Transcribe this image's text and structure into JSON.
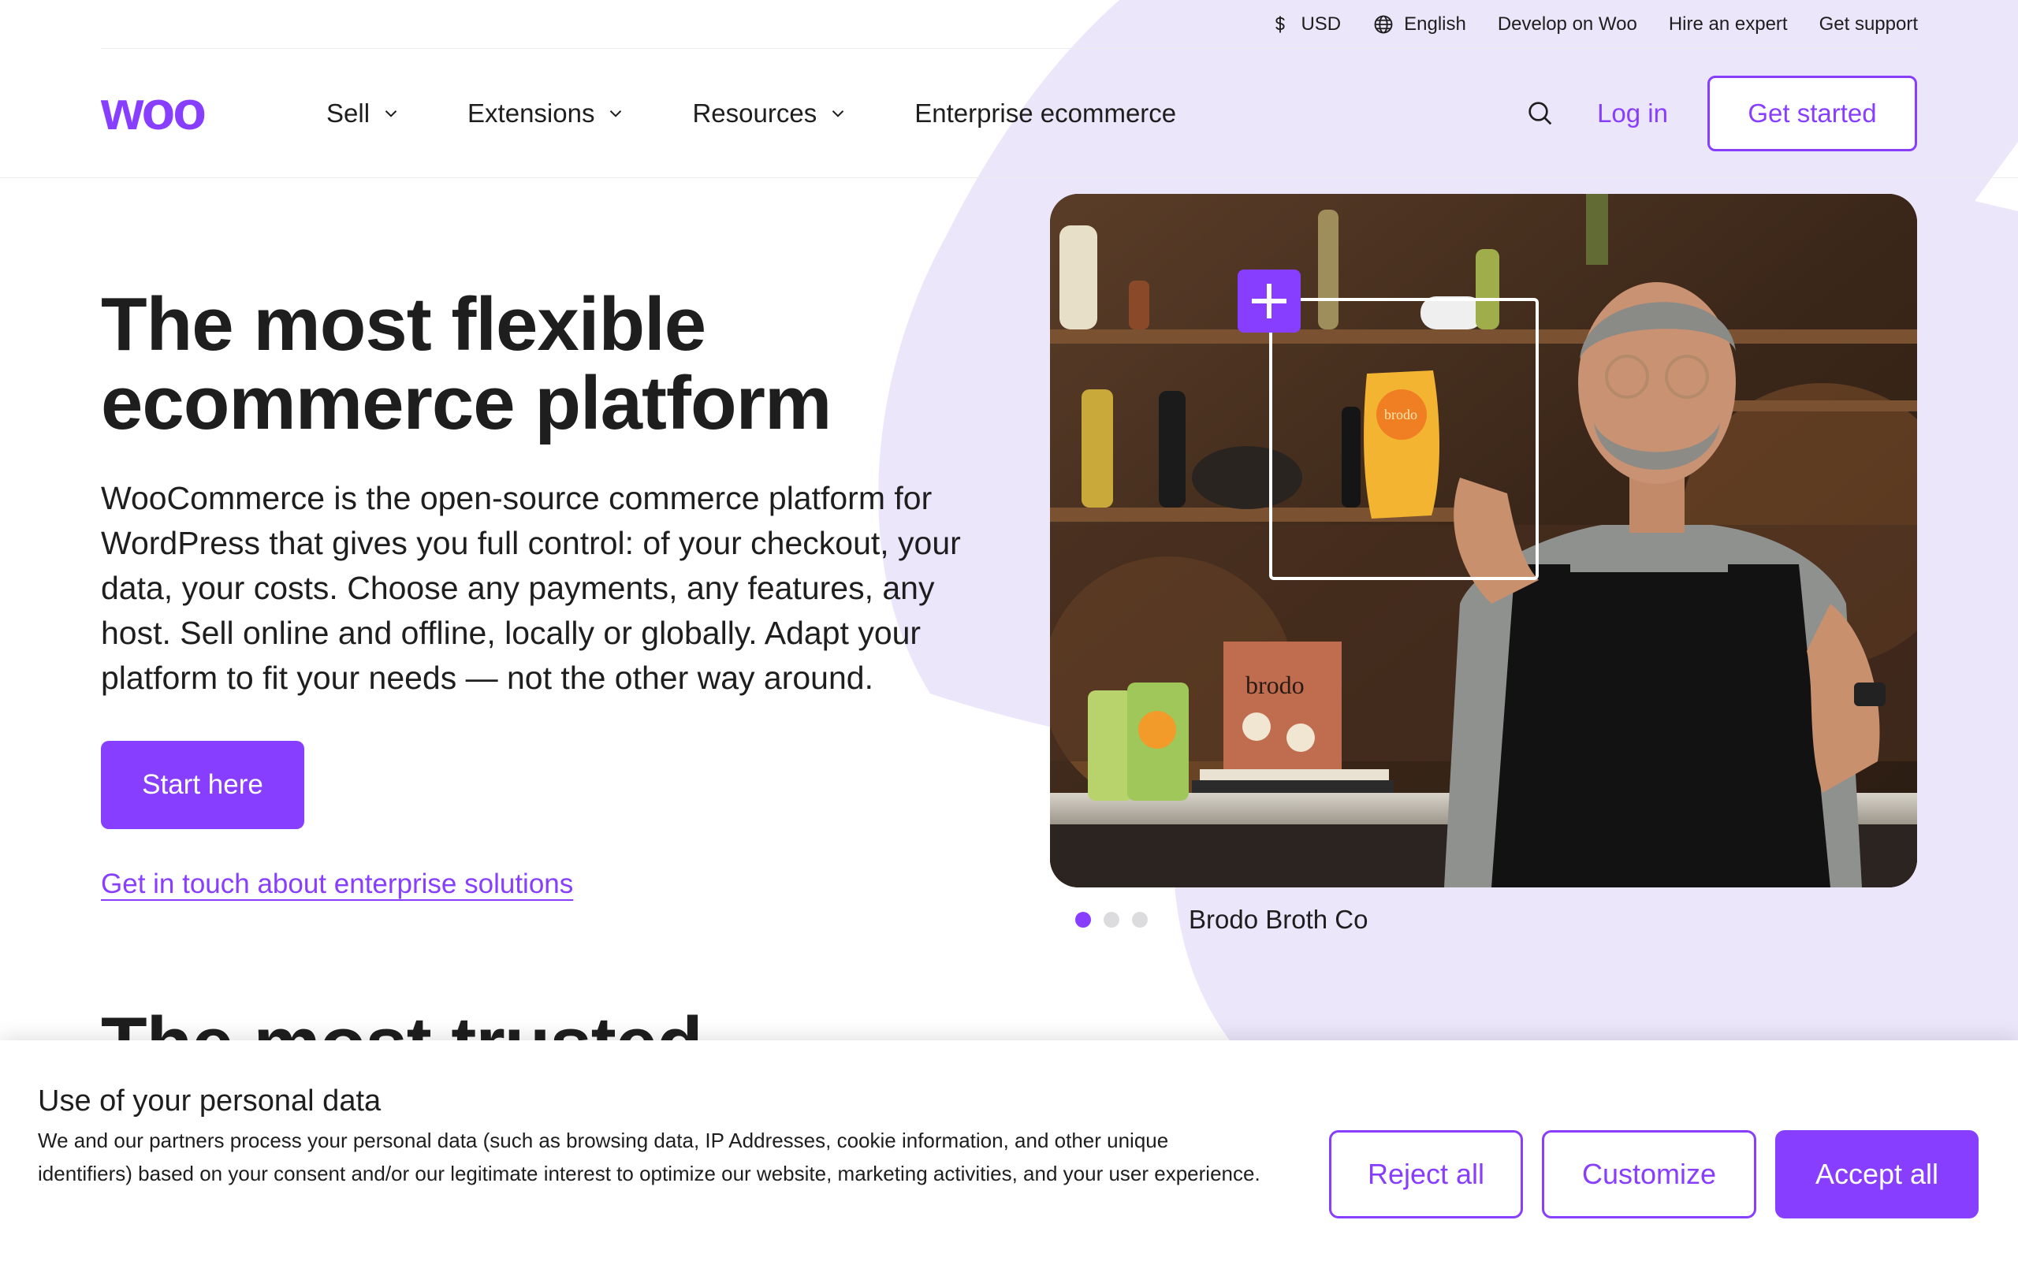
{
  "utility_bar": {
    "currency": "USD",
    "language": "English",
    "links": [
      "Develop on Woo",
      "Hire an expert",
      "Get support"
    ]
  },
  "header": {
    "logo_text": "woo",
    "nav": [
      "Sell",
      "Extensions",
      "Resources",
      "Enterprise ecommerce"
    ],
    "login": "Log in",
    "get_started": "Get started"
  },
  "hero": {
    "title_line1": "The most flexible",
    "title_line2": "ecommerce platform",
    "description": "WooCommerce is the open-source commerce platform for WordPress that gives you full control: of your checkout, your data, your costs. Choose any payments, any features, any host. Sell online and offline, locally or globally. Adapt your platform to fit your needs — not the other way around.",
    "cta": "Start here",
    "enterprise_link": "Get in touch about enterprise solutions",
    "caption": "Brodo Broth Co",
    "product_label": "brodo",
    "book_title": "brodo",
    "slide_count": 3,
    "active_slide": 1
  },
  "next_section": {
    "title": "The most trusted"
  },
  "cookie_banner": {
    "title": "Use of your personal data",
    "text": "We and our partners process your personal data (such as browsing data, IP Addresses, cookie information, and other unique identifiers) based on your consent and/or our legitimate interest to optimize our website, marketing activities, and your user experience.",
    "reject": "Reject all",
    "customize": "Customize",
    "accept": "Accept all"
  },
  "colors": {
    "brand": "#873eff",
    "blob": "#ece6fb",
    "text": "#1e1e1e"
  }
}
